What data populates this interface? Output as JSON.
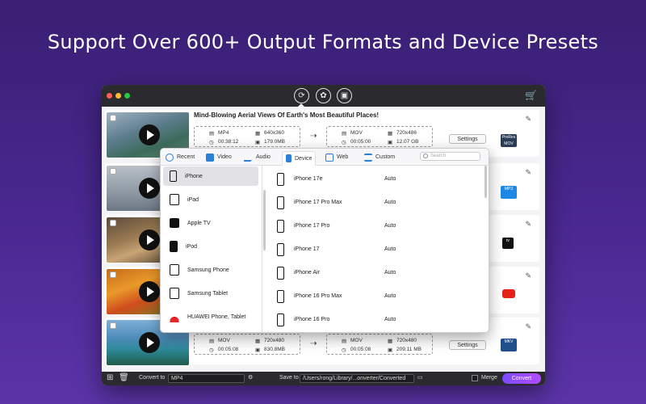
{
  "headline": "Support Over 600+ Output Formats and Device Presets",
  "colors": {
    "accent": "#8a4dff",
    "background": "#4a2891"
  },
  "titlebar": {
    "buttons": [
      "convert-icon",
      "film-reel-icon",
      "toolbox-icon"
    ]
  },
  "rows": [
    {
      "title": "Mind-Blowing Aerial Views Of Earth's Most Beautiful Places!",
      "src": {
        "format": "MP4",
        "resolution": "640x360",
        "duration": "00:38:12",
        "size": "179.0MB"
      },
      "dst": {
        "format": "MOV",
        "resolution": "720x486",
        "duration": "00:05:00",
        "size": "12.07 GB"
      },
      "settings": "Settings",
      "preset": "ProRes MOV"
    },
    {
      "preset": "MP3"
    },
    {
      "preset": "tv"
    },
    {
      "preset": "youtube"
    },
    {
      "src": {
        "format": "MOV",
        "resolution": "720x480",
        "duration": "00:05:08",
        "size": "830.8MB"
      },
      "dst": {
        "format": "MOV",
        "resolution": "720x480",
        "duration": "00:05:08",
        "size": "209.11 MB"
      },
      "settings": "Settings",
      "preset": "MKV"
    }
  ],
  "popup": {
    "tabs": [
      "Recent",
      "Video",
      "Audio",
      "Device",
      "Web",
      "Custom"
    ],
    "active_tab": "Device",
    "search_placeholder": "Search",
    "categories": [
      "iPhone",
      "iPad",
      "Apple TV",
      "iPod",
      "Samsung Phone",
      "Samsung Tablet",
      "HUAWEI Phone, Tablet"
    ],
    "active_category": "iPhone",
    "devices": [
      {
        "name": "iPhone 17e",
        "res": "Auto"
      },
      {
        "name": "iPhone 17 Pro Max",
        "res": "Auto"
      },
      {
        "name": "iPhone 17 Pro",
        "res": "Auto"
      },
      {
        "name": "iPhone 17",
        "res": "Auto"
      },
      {
        "name": "iPhone Air",
        "res": "Auto"
      },
      {
        "name": "iPhone 16 Pro Max",
        "res": "Auto"
      },
      {
        "name": "iPhone 16 Pro",
        "res": "Auto"
      }
    ]
  },
  "bottombar": {
    "convert_to_label": "Convert to",
    "convert_to_value": "MP4",
    "save_to_label": "Save to",
    "save_to_value": "/Users/rong/Library/...onverter/Converted",
    "merge_label": "Merge",
    "convert_button": "Convert"
  }
}
